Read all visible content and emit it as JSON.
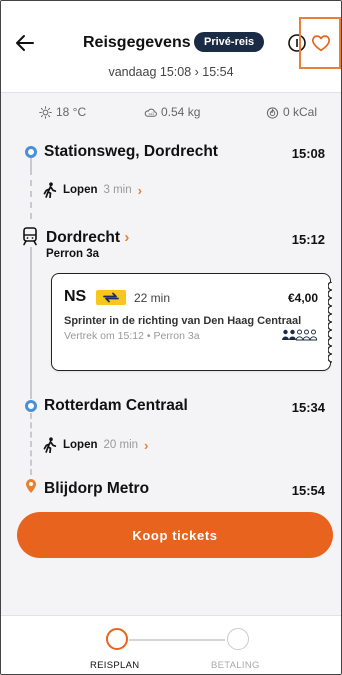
{
  "header": {
    "title": "Reisgegevens",
    "badge": "Privé-reis",
    "subtitle": "vandaag 15:08  ›  15:54"
  },
  "stats": {
    "temperature": "18 °C",
    "co2": "0.54 kg",
    "calories": "0 kCal"
  },
  "journey": {
    "stop1": {
      "name": "Stationsweg, Dordrecht",
      "time": "15:08"
    },
    "walk1": {
      "label": "Lopen",
      "duration": "3 min"
    },
    "stop2": {
      "name": "Dordrecht",
      "platform": "Perron 3a",
      "time": "15:12"
    },
    "ticket": {
      "operator": "NS",
      "duration": "22 min",
      "price": "€4,00",
      "description": "Sprinter in de richting van Den Haag Centraal",
      "departure": "Vertrek om 15:12 • Perron 3a"
    },
    "stop3": {
      "name": "Rotterdam Centraal",
      "time": "15:34"
    },
    "walk2": {
      "label": "Lopen",
      "duration": "20 min"
    },
    "stop4": {
      "name": "Blijdorp Metro",
      "time": "15:54"
    }
  },
  "actions": {
    "buy_tickets": "Koop tickets"
  },
  "stepper": {
    "step1": "REISPLAN",
    "step2": "BETALING"
  },
  "colors": {
    "accent": "#e8641e",
    "timeline_blue": "#4a8fd8",
    "badge_navy": "#1a2b45",
    "ns_yellow": "#f7c719"
  }
}
